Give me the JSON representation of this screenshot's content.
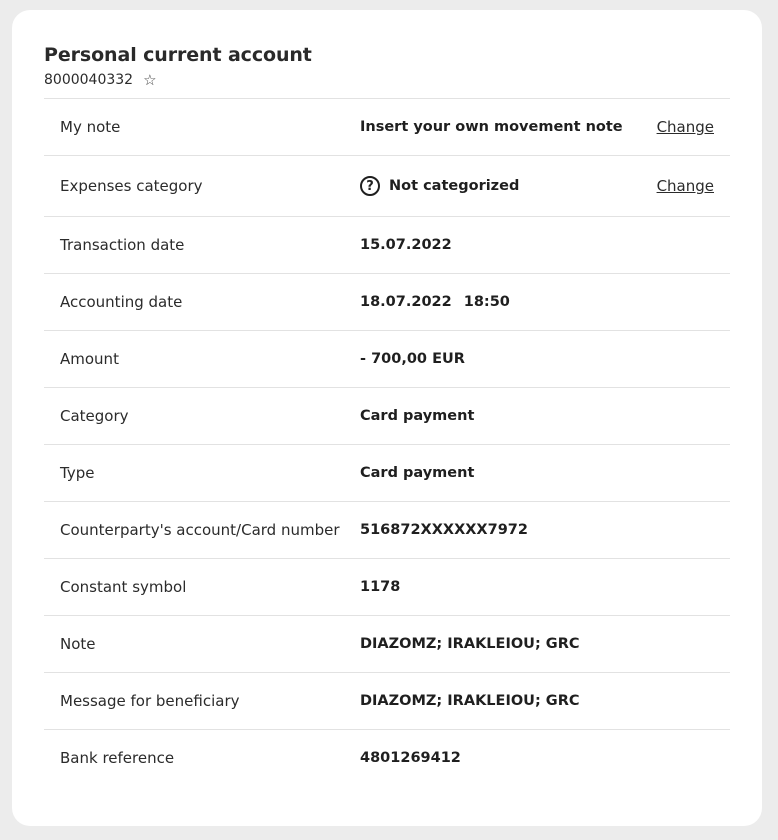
{
  "account": {
    "title": "Personal current account",
    "number": "8000040332",
    "favorite_icon": "star-outline-icon"
  },
  "rows": [
    {
      "label": "My note",
      "value": "Insert your own movement note",
      "action": "Change"
    },
    {
      "label": "Expenses category",
      "value": "Not categorized",
      "action": "Change",
      "icon": "question-circle-icon"
    },
    {
      "label": "Transaction date",
      "value": "15.07.2022"
    },
    {
      "label": "Accounting date",
      "value": "18.07.2022",
      "time": "18:50"
    },
    {
      "label": "Amount",
      "value": "- 700,00 EUR"
    },
    {
      "label": "Category",
      "value": "Card payment"
    },
    {
      "label": "Type",
      "value": "Card payment"
    },
    {
      "label": "Counterparty's account/Card number",
      "value": "516872XXXXXX7972"
    },
    {
      "label": "Constant symbol",
      "value": "1178"
    },
    {
      "label": "Note",
      "value": "DIAZOMZ; IRAKLEIOU; GRC"
    },
    {
      "label": "Message for beneficiary",
      "value": "DIAZOMZ; IRAKLEIOU; GRC"
    },
    {
      "label": "Bank reference",
      "value": "4801269412"
    }
  ]
}
